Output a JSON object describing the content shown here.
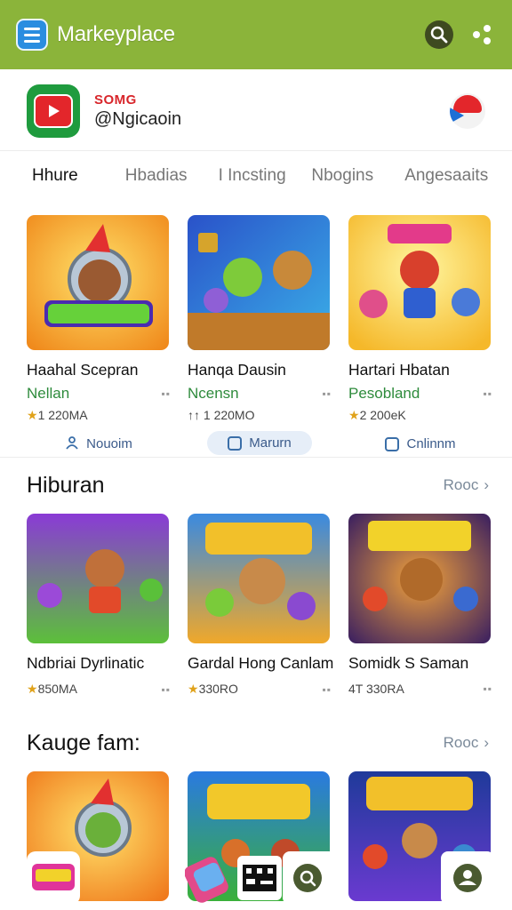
{
  "app": {
    "title": "Markeyplace",
    "search_icon": "search-icon",
    "share_icon": "share-icon"
  },
  "profile": {
    "badge": "SOMG",
    "handle": "@Ngicaoin"
  },
  "tabs": [
    "Hhure",
    "Hbadias",
    "I Incsting",
    "Nbogins",
    "Angesaaits"
  ],
  "featured": [
    {
      "title": "Haahal Scepran",
      "sub": "Nellan",
      "rating": "1 220MA",
      "action": "Nouoim",
      "highlight": false
    },
    {
      "title": "Hanqa Dausin",
      "sub": "Ncensn",
      "rating": "1 220MO",
      "action": "Marurn",
      "highlight": true
    },
    {
      "title": "Hartari Hbatan",
      "sub": "Pesobland",
      "rating": "2 200eK",
      "action": "Cnlinnm",
      "highlight": false
    }
  ],
  "section1": {
    "title": "Hiburan",
    "more": "Rooc",
    "items": [
      {
        "title": "Ndbriai Dyrlinatic",
        "rating": "850MA"
      },
      {
        "title": "Gardal Hong Canlam",
        "rating": "330RO"
      },
      {
        "title": "Somidk S Saman",
        "rating": "4T 330RA"
      }
    ]
  },
  "section2": {
    "title": "Kauge fam:",
    "more": "Rooc"
  },
  "colors": {
    "brand_bar": "#8bb43a",
    "accent_green": "#2e8b3c",
    "star": "#e0a21a"
  }
}
